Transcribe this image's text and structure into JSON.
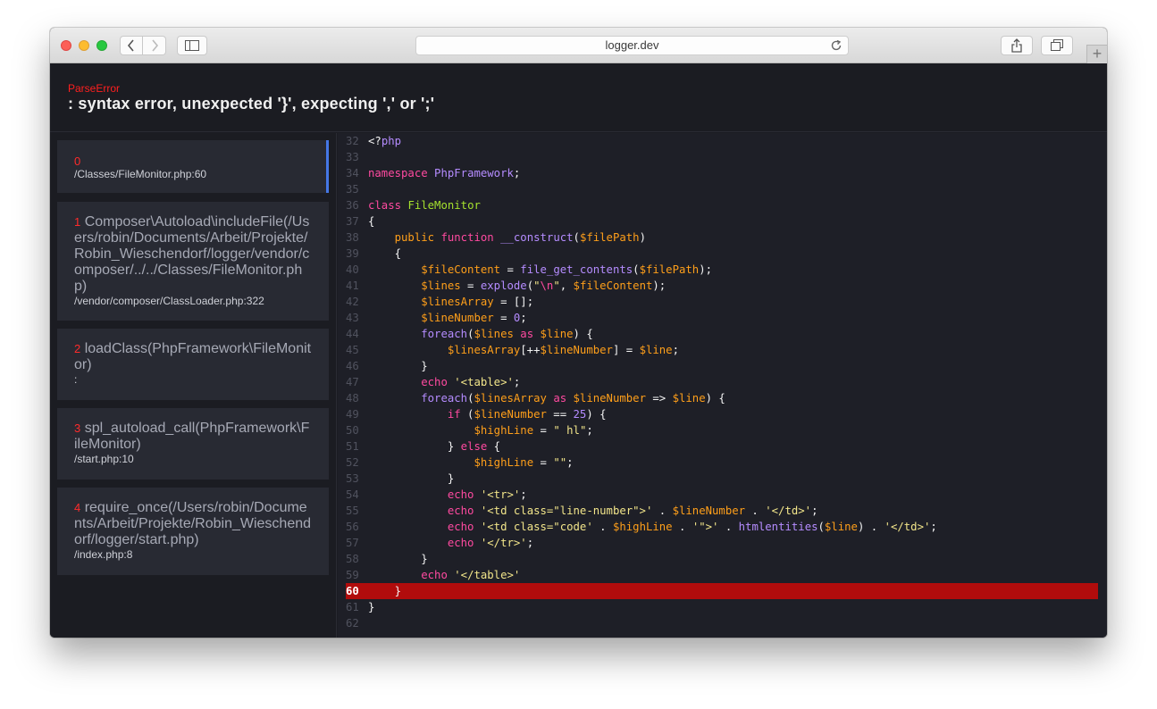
{
  "browser": {
    "url": "logger.dev"
  },
  "error": {
    "type": "ParseError",
    "message": ": syntax error, unexpected '}', expecting ',' or ';'"
  },
  "stack_frames": [
    {
      "index": "0",
      "func": "",
      "file": "/Classes/FileMonitor.php:60"
    },
    {
      "index": "1",
      "func": "Composer\\Autoload\\includeFile(/Users/robin/Documents/Arbeit/Projekte/Robin_Wieschendorf/logger/vendor/composer/../../Classes/FileMonitor.php)",
      "file": "/vendor/composer/ClassLoader.php:322"
    },
    {
      "index": "2",
      "func": "loadClass(PhpFramework\\FileMonitor)",
      "file": ":"
    },
    {
      "index": "3",
      "func": "spl_autoload_call(PhpFramework\\FileMonitor)",
      "file": "/start.php:10"
    },
    {
      "index": "4",
      "func": "require_once(/Users/robin/Documents/Arbeit/Projekte/Robin_Wieschendorf/logger/start.php)",
      "file": "/index.php:8"
    }
  ],
  "colors": {
    "keyword": "#ff4aa0",
    "variable": "#ff9f1a",
    "function": "#b58cff",
    "string": "#f2e58a",
    "number": "#b58cff",
    "class_name": "#a6e22e",
    "plain": "#f4f4f4",
    "error_line": "#b10c0c",
    "active_frame": "#4577e6"
  },
  "code": {
    "highlight_line": "60",
    "lines": [
      {
        "n": "32",
        "tokens": [
          [
            "<?",
            "p"
          ],
          [
            "php",
            "f"
          ]
        ]
      },
      {
        "n": "33",
        "tokens": []
      },
      {
        "n": "34",
        "tokens": [
          [
            "namespace",
            "k"
          ],
          [
            " ",
            "p"
          ],
          [
            "PhpFramework",
            "f"
          ],
          [
            ";",
            "p"
          ]
        ]
      },
      {
        "n": "35",
        "tokens": []
      },
      {
        "n": "36",
        "tokens": [
          [
            "class",
            "k"
          ],
          [
            " ",
            "p"
          ],
          [
            "FileMonitor",
            "c"
          ]
        ]
      },
      {
        "n": "37",
        "tokens": [
          [
            "{",
            "p"
          ]
        ]
      },
      {
        "n": "38",
        "tokens": [
          [
            "    ",
            "p"
          ],
          [
            "public",
            "v"
          ],
          [
            " ",
            "p"
          ],
          [
            "function",
            "k"
          ],
          [
            " ",
            "p"
          ],
          [
            "__construct",
            "f"
          ],
          [
            "(",
            "p"
          ],
          [
            "$filePath",
            "v"
          ],
          [
            ")",
            "p"
          ]
        ]
      },
      {
        "n": "39",
        "tokens": [
          [
            "    {",
            "p"
          ]
        ]
      },
      {
        "n": "40",
        "tokens": [
          [
            "        ",
            "p"
          ],
          [
            "$fileContent",
            "v"
          ],
          [
            " = ",
            "p"
          ],
          [
            "file_get_contents",
            "f"
          ],
          [
            "(",
            "p"
          ],
          [
            "$filePath",
            "v"
          ],
          [
            ");",
            "p"
          ]
        ]
      },
      {
        "n": "41",
        "tokens": [
          [
            "        ",
            "p"
          ],
          [
            "$lines",
            "v"
          ],
          [
            " = ",
            "p"
          ],
          [
            "explode",
            "f"
          ],
          [
            "(",
            "p"
          ],
          [
            "\"",
            "s"
          ],
          [
            "\\n",
            "k"
          ],
          [
            "\"",
            "s"
          ],
          [
            ", ",
            "p"
          ],
          [
            "$fileContent",
            "v"
          ],
          [
            ");",
            "p"
          ]
        ]
      },
      {
        "n": "42",
        "tokens": [
          [
            "        ",
            "p"
          ],
          [
            "$linesArray",
            "v"
          ],
          [
            " = ",
            "p"
          ],
          [
            "[];",
            "p"
          ]
        ]
      },
      {
        "n": "43",
        "tokens": [
          [
            "        ",
            "p"
          ],
          [
            "$lineNumber",
            "v"
          ],
          [
            " = ",
            "p"
          ],
          [
            "0",
            "f"
          ],
          [
            ";",
            "p"
          ]
        ]
      },
      {
        "n": "44",
        "tokens": [
          [
            "        ",
            "p"
          ],
          [
            "foreach",
            "f"
          ],
          [
            "(",
            "p"
          ],
          [
            "$lines",
            "v"
          ],
          [
            " ",
            "p"
          ],
          [
            "as",
            "k"
          ],
          [
            " ",
            "p"
          ],
          [
            "$line",
            "v"
          ],
          [
            ") {",
            "p"
          ]
        ]
      },
      {
        "n": "45",
        "tokens": [
          [
            "            ",
            "p"
          ],
          [
            "$linesArray",
            "v"
          ],
          [
            "[++",
            "p"
          ],
          [
            "$lineNumber",
            "v"
          ],
          [
            "] = ",
            "p"
          ],
          [
            "$line",
            "v"
          ],
          [
            ";",
            "p"
          ]
        ]
      },
      {
        "n": "46",
        "tokens": [
          [
            "        }",
            "p"
          ]
        ]
      },
      {
        "n": "47",
        "tokens": [
          [
            "        ",
            "p"
          ],
          [
            "echo",
            "k"
          ],
          [
            " ",
            "p"
          ],
          [
            "'<table>'",
            "s"
          ],
          [
            ";",
            "p"
          ]
        ]
      },
      {
        "n": "48",
        "tokens": [
          [
            "        ",
            "p"
          ],
          [
            "foreach",
            "f"
          ],
          [
            "(",
            "p"
          ],
          [
            "$linesArray",
            "v"
          ],
          [
            " ",
            "p"
          ],
          [
            "as",
            "k"
          ],
          [
            " ",
            "p"
          ],
          [
            "$lineNumber",
            "v"
          ],
          [
            " => ",
            "p"
          ],
          [
            "$line",
            "v"
          ],
          [
            ") {",
            "p"
          ]
        ]
      },
      {
        "n": "49",
        "tokens": [
          [
            "            ",
            "p"
          ],
          [
            "if",
            "k"
          ],
          [
            " (",
            "p"
          ],
          [
            "$lineNumber",
            "v"
          ],
          [
            " == ",
            "p"
          ],
          [
            "25",
            "f"
          ],
          [
            ") {",
            "p"
          ]
        ]
      },
      {
        "n": "50",
        "tokens": [
          [
            "                ",
            "p"
          ],
          [
            "$highLine",
            "v"
          ],
          [
            " = ",
            "p"
          ],
          [
            "\" hl\"",
            "s"
          ],
          [
            ";",
            "p"
          ]
        ]
      },
      {
        "n": "51",
        "tokens": [
          [
            "            } ",
            "p"
          ],
          [
            "else",
            "k"
          ],
          [
            " {",
            "p"
          ]
        ]
      },
      {
        "n": "52",
        "tokens": [
          [
            "                ",
            "p"
          ],
          [
            "$highLine",
            "v"
          ],
          [
            " = ",
            "p"
          ],
          [
            "\"\"",
            "s"
          ],
          [
            ";",
            "p"
          ]
        ]
      },
      {
        "n": "53",
        "tokens": [
          [
            "            }",
            "p"
          ]
        ]
      },
      {
        "n": "54",
        "tokens": [
          [
            "            ",
            "p"
          ],
          [
            "echo",
            "k"
          ],
          [
            " ",
            "p"
          ],
          [
            "'<tr>'",
            "s"
          ],
          [
            ";",
            "p"
          ]
        ]
      },
      {
        "n": "55",
        "tokens": [
          [
            "            ",
            "p"
          ],
          [
            "echo",
            "k"
          ],
          [
            " ",
            "p"
          ],
          [
            "'<td class=\"line-number\">'",
            "s"
          ],
          [
            " . ",
            "p"
          ],
          [
            "$lineNumber",
            "v"
          ],
          [
            " . ",
            "p"
          ],
          [
            "'</td>'",
            "s"
          ],
          [
            ";",
            "p"
          ]
        ]
      },
      {
        "n": "56",
        "tokens": [
          [
            "            ",
            "p"
          ],
          [
            "echo",
            "k"
          ],
          [
            " ",
            "p"
          ],
          [
            "'<td class=\"code'",
            "s"
          ],
          [
            " . ",
            "p"
          ],
          [
            "$highLine",
            "v"
          ],
          [
            " . ",
            "p"
          ],
          [
            "'\">'",
            "s"
          ],
          [
            " . ",
            "p"
          ],
          [
            "htmlentities",
            "f"
          ],
          [
            "(",
            "p"
          ],
          [
            "$line",
            "v"
          ],
          [
            ") . ",
            "p"
          ],
          [
            "'</td>'",
            "s"
          ],
          [
            ";",
            "p"
          ]
        ]
      },
      {
        "n": "57",
        "tokens": [
          [
            "            ",
            "p"
          ],
          [
            "echo",
            "k"
          ],
          [
            " ",
            "p"
          ],
          [
            "'</tr>'",
            "s"
          ],
          [
            ";",
            "p"
          ]
        ]
      },
      {
        "n": "58",
        "tokens": [
          [
            "        }",
            "p"
          ]
        ]
      },
      {
        "n": "59",
        "tokens": [
          [
            "        ",
            "p"
          ],
          [
            "echo",
            "k"
          ],
          [
            " ",
            "p"
          ],
          [
            "'</table>'",
            "s"
          ]
        ]
      },
      {
        "n": "60",
        "tokens": [
          [
            "    }",
            "p"
          ]
        ]
      },
      {
        "n": "61",
        "tokens": [
          [
            "}",
            "p"
          ]
        ]
      },
      {
        "n": "62",
        "tokens": []
      }
    ]
  }
}
